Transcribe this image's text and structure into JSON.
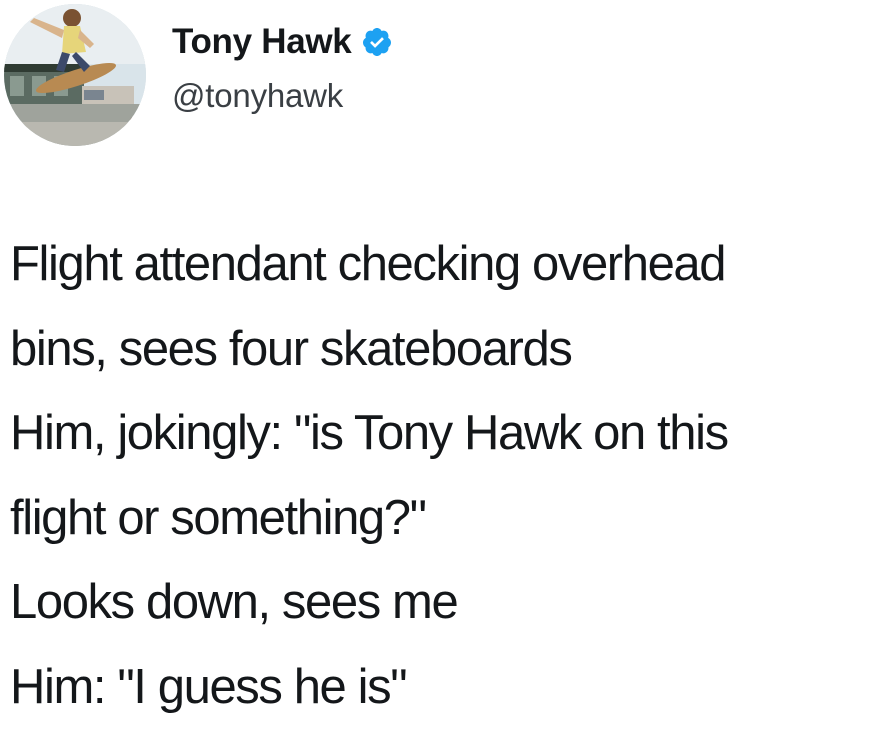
{
  "tweet": {
    "author": {
      "display_name": "Tony Hawk",
      "handle": "@tonyhawk",
      "verified": true,
      "verified_icon": "verified-badge-icon",
      "avatar_icon": "avatar-skateboarder-photo"
    },
    "lines": [
      "Flight attendant checking overhead",
      "bins, sees four skateboards",
      "Him, jokingly: \"is Tony Hawk on this",
      "flight or something?\"",
      "Looks down, sees me",
      "Him: \"I guess he is\""
    ]
  },
  "colors": {
    "text": "#14171a",
    "handle": "#3a3f44",
    "verified": "#1da1f2",
    "background": "#ffffff"
  }
}
